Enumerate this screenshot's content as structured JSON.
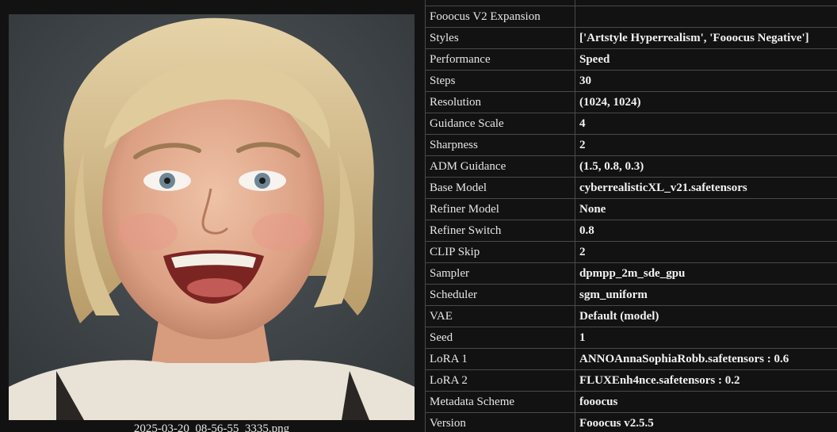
{
  "image": {
    "filename": "2025-03-20_08-56-55_3335.png",
    "description_icon": "generated-portrait-image"
  },
  "metadata": {
    "rows": [
      {
        "key": "",
        "value": ""
      },
      {
        "key": "Fooocus V2 Expansion",
        "value": ""
      },
      {
        "key": "Styles",
        "value": "['Artstyle Hyperrealism', 'Fooocus Negative']"
      },
      {
        "key": "Performance",
        "value": "Speed"
      },
      {
        "key": "Steps",
        "value": "30"
      },
      {
        "key": "Resolution",
        "value": "(1024, 1024)"
      },
      {
        "key": "Guidance Scale",
        "value": "4"
      },
      {
        "key": "Sharpness",
        "value": "2"
      },
      {
        "key": "ADM Guidance",
        "value": "(1.5, 0.8, 0.3)"
      },
      {
        "key": "Base Model",
        "value": "cyberrealisticXL_v21.safetensors"
      },
      {
        "key": "Refiner Model",
        "value": "None"
      },
      {
        "key": "Refiner Switch",
        "value": "0.8"
      },
      {
        "key": "CLIP Skip",
        "value": "2"
      },
      {
        "key": "Sampler",
        "value": "dpmpp_2m_sde_gpu"
      },
      {
        "key": "Scheduler",
        "value": "sgm_uniform"
      },
      {
        "key": "VAE",
        "value": "Default (model)"
      },
      {
        "key": "Seed",
        "value": "1"
      },
      {
        "key": "LoRA 1",
        "value": "ANNOAnnaSophiaRobb.safetensors : 0.6"
      },
      {
        "key": "LoRA 2",
        "value": "FLUXEnh4nce.safetensors : 0.2"
      },
      {
        "key": "Metadata Scheme",
        "value": "fooocus"
      },
      {
        "key": "Version",
        "value": "Fooocus v2.5.5"
      }
    ]
  }
}
